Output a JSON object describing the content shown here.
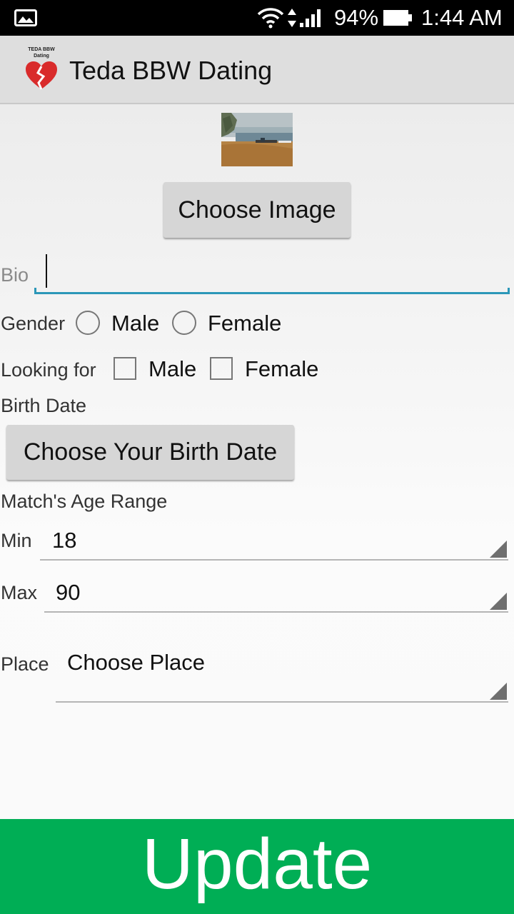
{
  "status_bar": {
    "battery_percent": "94%",
    "battery_level": 0.94,
    "time": "1:44 AM",
    "icons": [
      "gallery-icon",
      "wifi-icon",
      "data-transfer-icon",
      "signal-icon",
      "battery-icon"
    ]
  },
  "app_bar": {
    "title": "Teda BBW Dating",
    "logo_text_line1": "TEDA BBW",
    "logo_text_line2": "Dating"
  },
  "profile": {
    "choose_image_label": "Choose Image",
    "bio_hint": "Bio",
    "bio_value": "",
    "gender_label": "Gender",
    "gender_options": [
      "Male",
      "Female"
    ],
    "looking_for_label": "Looking for",
    "looking_for_options": [
      "Male",
      "Female"
    ],
    "birth_date_label": "Birth Date",
    "birth_date_button": "Choose Your Birth Date",
    "age_range_label": "Match's Age Range",
    "min_label": "Min",
    "min_value": "18",
    "max_label": "Max",
    "max_value": "90",
    "place_label": "Place",
    "place_value": "Choose Place"
  },
  "update_label": "Update",
  "colors": {
    "status_bar": "#000000",
    "app_bar": "#dedede",
    "accent": "#2b97b8",
    "update_button": "#00ae55",
    "button": "#d6d6d6"
  }
}
